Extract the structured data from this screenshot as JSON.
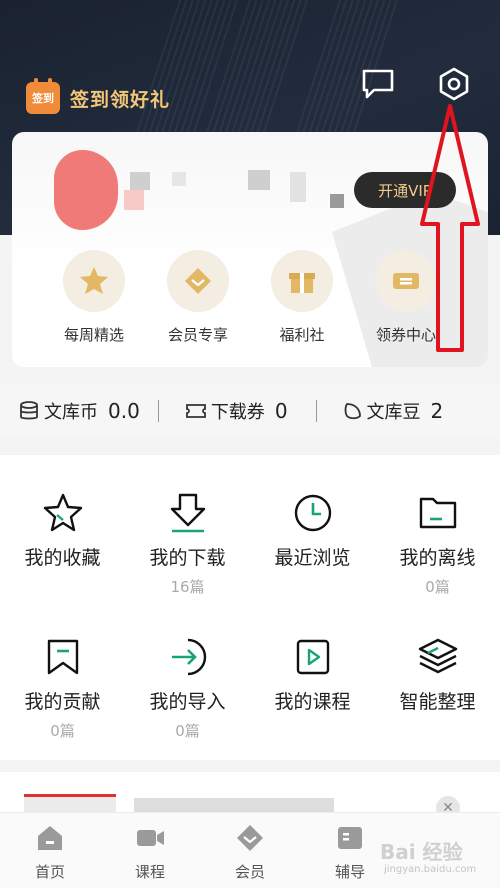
{
  "header": {
    "signin_badge": "签到",
    "signin_label": "签到领好礼",
    "message_icon": "chat-bubble-icon",
    "settings_icon": "hexagon-gear-icon"
  },
  "profile": {
    "vip_button": "开通VIP"
  },
  "quick_links": [
    {
      "label": "每周精选",
      "icon": "star-ribbon-icon"
    },
    {
      "label": "会员专享",
      "icon": "diamond-heart-icon"
    },
    {
      "label": "福利社",
      "icon": "gift-icon"
    },
    {
      "label": "领券中心",
      "icon": "ticket-icon"
    }
  ],
  "stats": [
    {
      "label": "文库币",
      "value": "0.0",
      "icon": "coin-stack-icon"
    },
    {
      "label": "下载券",
      "value": "0",
      "icon": "ticket-outline-icon"
    },
    {
      "label": "文库豆",
      "value": "2",
      "icon": "bean-icon"
    }
  ],
  "grid": [
    {
      "label": "我的收藏",
      "sub": "",
      "icon": "star-outline-icon"
    },
    {
      "label": "我的下载",
      "sub": "16篇",
      "icon": "download-icon"
    },
    {
      "label": "最近浏览",
      "sub": "",
      "icon": "clock-icon"
    },
    {
      "label": "我的离线",
      "sub": "0篇",
      "icon": "folder-icon"
    },
    {
      "label": "我的贡献",
      "sub": "0篇",
      "icon": "bookmark-icon"
    },
    {
      "label": "我的导入",
      "sub": "0篇",
      "icon": "import-icon"
    },
    {
      "label": "我的课程",
      "sub": "",
      "icon": "play-square-icon"
    },
    {
      "label": "智能整理",
      "sub": "",
      "icon": "layers-icon"
    }
  ],
  "tabs": [
    {
      "label": "首页",
      "icon": "home-icon"
    },
    {
      "label": "课程",
      "icon": "video-icon"
    },
    {
      "label": "会员",
      "icon": "diamond-icon"
    },
    {
      "label": "辅导",
      "icon": "book-icon"
    }
  ],
  "watermark": {
    "text": "Bai 经验",
    "sub": "jingyan.baidu.com"
  },
  "colors": {
    "accent_gold": "#f3c678",
    "accent_green": "#1aa37a",
    "annotation_red": "#e0141e"
  }
}
